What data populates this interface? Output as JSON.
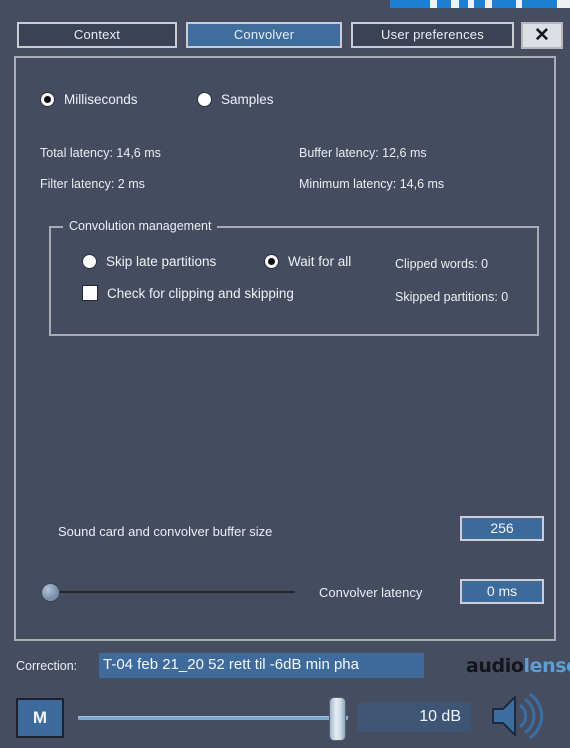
{
  "window": {
    "close_label": "✕"
  },
  "tabs": [
    {
      "label": "Context",
      "active": false
    },
    {
      "label": "Convolver",
      "active": true
    },
    {
      "label": "User preferences",
      "active": false
    }
  ],
  "units": {
    "milliseconds_label": "Milliseconds",
    "samples_label": "Samples",
    "selected": "Milliseconds"
  },
  "latency": {
    "total": "Total latency: 14,6 ms",
    "filter": "Filter latency: 2 ms",
    "buffer": "Buffer latency: 12,6 ms",
    "minimum": "Minimum latency: 14,6 ms"
  },
  "convolution_management": {
    "title": "Convolution management",
    "skip_late_partitions_label": "Skip late partitions",
    "wait_for_all_label": "Wait for all",
    "check_clipping_label": "Check for clipping and skipping",
    "selected_mode": "Wait for all",
    "check_clipping_checked": false,
    "clipped_words": "Clipped words: 0",
    "skipped_partitions": "Skipped partitions: 0"
  },
  "buffer": {
    "label": "Sound card and convolver buffer size",
    "value": "256"
  },
  "convolver_latency": {
    "label": "Convolver latency",
    "value": "0 ms",
    "slider_percent": 0
  },
  "correction": {
    "label": "Correction:",
    "value": "T-04 feb 21_20 52 rett til -6dB min pha"
  },
  "logo": {
    "part_one": "audio",
    "part_two": "lense",
    "icon": "speaker-icon"
  },
  "volume": {
    "mute_label": "M",
    "value": "10 dB",
    "slider_percent": 93
  },
  "colors": {
    "window_bg": "#474d61",
    "panel_bg": "#464c5f",
    "panel_border": "#a9aeb6",
    "accent_blue": "#3f6d9e",
    "value_blue": "#3c6a9b",
    "text": "#eaeef4",
    "logo_blue": "#5c9fd6",
    "strip_blue": "#1d7fd4"
  }
}
